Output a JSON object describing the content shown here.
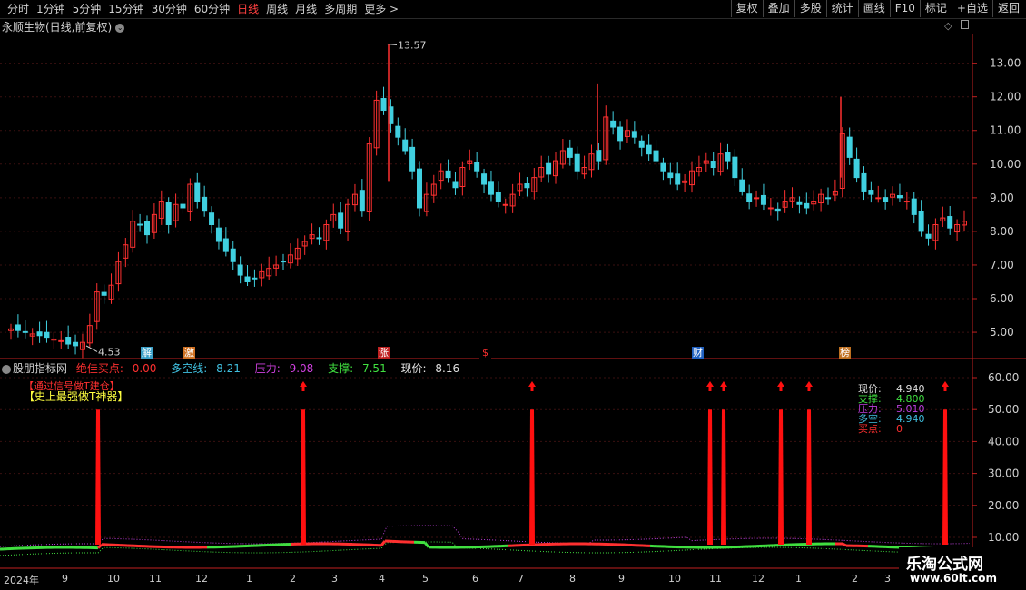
{
  "toolbar": {
    "periods": [
      "分时",
      "1分钟",
      "5分钟",
      "15分钟",
      "30分钟",
      "60分钟",
      "日线",
      "周线",
      "月线",
      "多周期",
      "更多 >"
    ],
    "active": "日线",
    "buttons": [
      "复权",
      "叠加",
      "多股",
      "统计",
      "画线",
      "F10",
      "标记",
      "+自选",
      "返回"
    ]
  },
  "stock": {
    "title": "永顺生物(日线,前复权)"
  },
  "price_axis": [
    "13.00",
    "12.00",
    "11.00",
    "10.00",
    "9.00",
    "8.00",
    "7.00",
    "6.00",
    "5.00"
  ],
  "annotations": {
    "high": "13.57",
    "low": "4.53"
  },
  "events": [
    {
      "label": "解",
      "color": "#3aa0c8"
    },
    {
      "label": "激",
      "color": "#d07020"
    },
    {
      "label": "涨",
      "color": "#c02020"
    },
    {
      "label": "$",
      "color": "#000000"
    },
    {
      "label": "财",
      "color": "#2060c0"
    },
    {
      "label": "榜",
      "color": "#c07020"
    }
  ],
  "indicator": {
    "name": "股朋指标网",
    "best_buy_label": "绝佳买点:",
    "best_buy_value": "0.00",
    "duokong_label": "多空线:",
    "duokong_value": "8.21",
    "pressure_label": "压力:",
    "pressure_value": "9.08",
    "support_label": "支撑:",
    "support_value": "7.51",
    "price_label": "现价:",
    "price_value": "8.16",
    "tag_red": "【通过信号做T建仓】",
    "tag_yellow": "【史上最强做T神器】"
  },
  "legend": [
    {
      "k": "现价:",
      "v": "4.940",
      "color": "#e0e0e0"
    },
    {
      "k": "支撑:",
      "v": "4.800",
      "color": "#40e040"
    },
    {
      "k": "压力:",
      "v": "5.010",
      "color": "#c040e0"
    },
    {
      "k": "多空:",
      "v": "4.940",
      "color": "#40c0e0"
    },
    {
      "k": "买点:",
      "v": "0",
      "color": "#ff3030"
    }
  ],
  "ind_axis": [
    "60.00",
    "50.00",
    "40.00",
    "30.00",
    "20.00",
    "10.00"
  ],
  "x_axis": [
    "2024年",
    "9",
    "10",
    "11",
    "12",
    "1",
    "2",
    "3",
    "4",
    "5",
    "6",
    "7",
    "8",
    "9",
    "10",
    "11",
    "12",
    "1",
    "2",
    "3"
  ],
  "watermark": {
    "line1": "乐淘公式网",
    "line2": "www.60lt.com"
  },
  "colors": {
    "up": "#ff3030",
    "down": "#40d0e0",
    "support": "#40e040",
    "pressure": "#c040e0",
    "signal": "#ff1010"
  },
  "chart_data": {
    "type": "candlestick",
    "ylim": [
      4.3,
      13.8
    ],
    "close": [
      5.1,
      5.05,
      5.0,
      4.95,
      4.9,
      4.85,
      4.8,
      4.75,
      4.65,
      4.6,
      4.7,
      5.2,
      6.2,
      6.1,
      6.4,
      7.1,
      7.6,
      8.3,
      8.2,
      7.9,
      8.5,
      8.9,
      8.2,
      8.8,
      8.7,
      9.4,
      8.9,
      8.6,
      8.2,
      7.7,
      7.4,
      7.1,
      6.7,
      6.5,
      6.6,
      6.8,
      6.9,
      7.0,
      7.1,
      7.3,
      7.5,
      7.7,
      7.9,
      7.8,
      8.2,
      8.5,
      8.1,
      8.8,
      9.1,
      8.6,
      10.6,
      11.9,
      11.6,
      11.2,
      10.8,
      10.4,
      9.8,
      8.7,
      9.1,
      9.4,
      9.8,
      9.6,
      9.3,
      9.9,
      10.1,
      9.8,
      9.4,
      9.1,
      8.9,
      8.8,
      9.1,
      9.4,
      9.3,
      9.6,
      9.9,
      9.7,
      10.1,
      10.4,
      10.2,
      9.8,
      9.9,
      10.3,
      10.1,
      11.4,
      11.1,
      10.7,
      11.0,
      10.8,
      10.5,
      10.3,
      10.1,
      9.8,
      9.6,
      9.4,
      9.5,
      9.8,
      9.9,
      10.1,
      9.9,
      10.3,
      10.1,
      9.6,
      9.2,
      8.9,
      9.0,
      8.8,
      8.7,
      8.6,
      8.9,
      9.0,
      8.8,
      8.7,
      8.9,
      9.1,
      9.0,
      9.2,
      10.9,
      10.2,
      9.6,
      9.2,
      9.1,
      9.0,
      8.9,
      9.1,
      9.0,
      8.9,
      8.5,
      8.0,
      7.8,
      8.2,
      8.4,
      8.1,
      8.2,
      8.3
    ],
    "indicator_signals": [
      {
        "x": 108,
        "v": 50
      },
      {
        "x": 334,
        "v": 50
      },
      {
        "x": 586,
        "v": 50
      },
      {
        "x": 782,
        "v": 50
      },
      {
        "x": 797,
        "v": 50
      },
      {
        "x": 860,
        "v": 50
      },
      {
        "x": 891,
        "v": 50
      },
      {
        "x": 1041,
        "v": 50
      }
    ]
  }
}
